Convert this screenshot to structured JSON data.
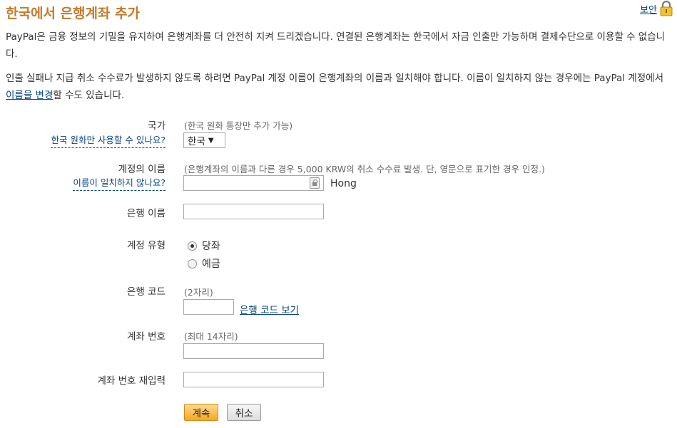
{
  "header": {
    "title": "한국에서 은행계좌 추가",
    "security_link": "보안",
    "lock_icon": "lock-icon"
  },
  "intro": {
    "p1": "PayPal은 금융 정보의 기밀을 유지하여 은행계좌를 더 안전히 지켜 드리겠습니다. 연결된 은행계좌는 한국에서 자금 인출만 가능하며 결제수단으로 이용할 수 없습니다.",
    "p2_before": "인출 실패나 지급 취소 수수료가 발생하지 않도록 하려면 PayPal 계정 이름이 은행계좌의 이름과 일치해야 합니다. 이름이 일치하지 않는 경우에는 PayPal 계정에서 ",
    "p2_link": "이름을 변경",
    "p2_after": "할 수도 있습니다."
  },
  "form": {
    "country": {
      "label": "국가",
      "help": "한국 원화만 사용할 수 있나요?",
      "hint": "(한국 원화 통장만 추가 가능)",
      "selected": "한국"
    },
    "account_name": {
      "label": "계정의 이름",
      "help": "이름이 일치하지 않나요?",
      "hint": "(은행계좌의 이름과 다른 경우 5,000 KRW의 취소 수수료 발생. 단, 영문으로 표기한 경우 인정.)",
      "value": "",
      "surname": "Hong"
    },
    "bank_name": {
      "label": "은행 이름",
      "value": ""
    },
    "account_type": {
      "label": "계정 유형",
      "options": [
        {
          "label": "당좌",
          "checked": true
        },
        {
          "label": "예금",
          "checked": false
        }
      ]
    },
    "bank_code": {
      "label": "은행 코드",
      "hint": "(2자리)",
      "value": "",
      "link": "은행 코드 보기"
    },
    "account_number": {
      "label": "계좌 번호",
      "hint": "(최대 14자리)",
      "value": ""
    },
    "account_number_confirm": {
      "label": "계좌 번호 재입력",
      "value": ""
    },
    "buttons": {
      "continue": "계속",
      "cancel": "취소"
    }
  },
  "colors": {
    "title": "#c47a2c",
    "link": "#084482",
    "primary_button": "#f6a821"
  }
}
